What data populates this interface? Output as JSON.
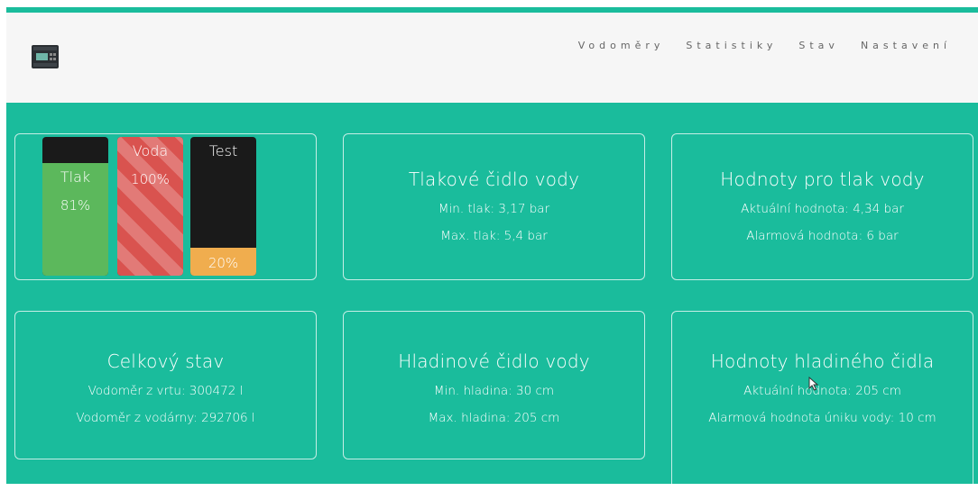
{
  "nav": [
    "Vodoměry",
    "Statistiky",
    "Stav",
    "Nastavení"
  ],
  "colors": {
    "accent": "#1abc9c",
    "green": "#5cb85c",
    "red": "#d9534f",
    "orange": "#f0ad4e",
    "dark": "#1a1a1a"
  },
  "gauges": [
    {
      "label": "Tlak",
      "percent": 81,
      "percent_text": "81%",
      "color": "#5cb85c",
      "striped": false
    },
    {
      "label": "Voda",
      "percent": 100,
      "percent_text": "100%",
      "color": "#d9534f",
      "striped": true
    },
    {
      "label": "Test",
      "percent": 20,
      "percent_text": "20%",
      "color": "#f0ad4e",
      "striped": false
    }
  ],
  "cards": {
    "pressure_sensor": {
      "title": "Tlakové čidlo vody",
      "line1": "Min. tlak: 3,17 bar",
      "line2": "Max. tlak: 5,4 bar"
    },
    "pressure_values": {
      "title": "Hodnoty pro tlak vody",
      "line1": "Aktuální hodnota: 4,34 bar",
      "line2": "Alarmová hodnota: 6 bar"
    },
    "overall": {
      "title": "Celkový stav",
      "line1": "Vodoměr z vrtu: 300472 l",
      "line2": "Vodoměr z vodárny: 292706 l"
    },
    "level_sensor": {
      "title": "Hladinové čidlo vody",
      "line1": "Min. hladina: 30 cm",
      "line2": "Max. hladina: 205 cm"
    },
    "level_values": {
      "title": "Hodnoty hladiného čidla",
      "line1": "Aktuální hodnota: 205 cm",
      "line2": "Alarmová hodnota úniku vody: 10 cm"
    }
  }
}
